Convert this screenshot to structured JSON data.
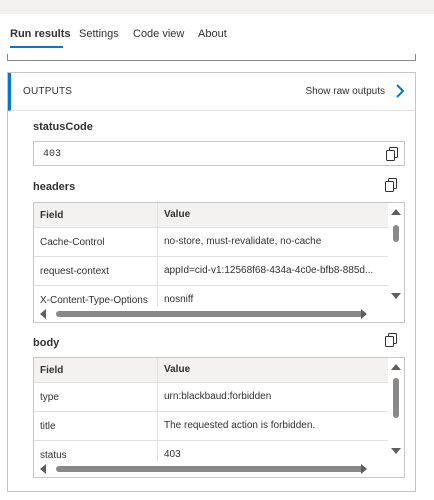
{
  "tabs": [
    {
      "label": "Run results",
      "active": true
    },
    {
      "label": "Settings",
      "active": false
    },
    {
      "label": "Code view",
      "active": false
    },
    {
      "label": "About",
      "active": false
    }
  ],
  "outputs": {
    "title": "OUTPUTS",
    "show_raw_label": "Show raw outputs",
    "status_code": {
      "label": "statusCode",
      "value": "403"
    },
    "headers": {
      "label": "headers",
      "columns": [
        "Field",
        "Value"
      ],
      "rows": [
        {
          "field": "Cache-Control",
          "value": "no-store, must-revalidate, no-cache"
        },
        {
          "field": "request-context",
          "value": "appId=cid-v1:12568f68-434a-4c0e-bfb8-885d..."
        },
        {
          "field": "X-Content-Type-Options",
          "value": "nosniff"
        }
      ]
    },
    "body": {
      "label": "body",
      "columns": [
        "Field",
        "Value"
      ],
      "rows": [
        {
          "field": "type",
          "value": "urn:blackbaud:forbidden"
        },
        {
          "field": "title",
          "value": "The requested action is forbidden."
        },
        {
          "field": "status",
          "value": "403"
        }
      ]
    }
  },
  "colors": {
    "accent": "#0078d4",
    "border": "#c8c6c4",
    "header_bg": "#f3f2f1",
    "scroll_thumb": "#8a8886"
  },
  "icons": [
    "chevron-right-icon",
    "copy-icon",
    "scroll-up-arrow",
    "scroll-down-arrow",
    "scroll-left-arrow",
    "scroll-right-arrow"
  ]
}
